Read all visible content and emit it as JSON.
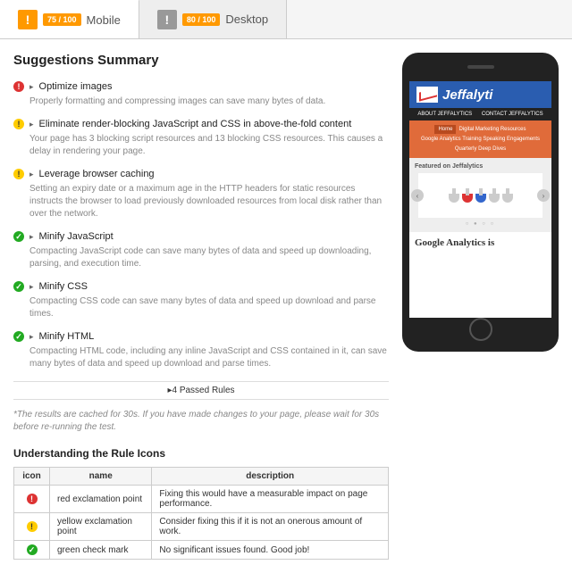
{
  "tabs": {
    "mobile": {
      "score": "75 / 100",
      "label": "Mobile"
    },
    "desktop": {
      "score": "80 / 100",
      "label": "Desktop"
    }
  },
  "summary_title": "Suggestions Summary",
  "suggestions": [
    {
      "severity": "red",
      "title": "Optimize images",
      "desc": "Properly formatting and compressing images can save many bytes of data."
    },
    {
      "severity": "yellow",
      "title": "Eliminate render-blocking JavaScript and CSS in above-the-fold content",
      "desc": "Your page has 3 blocking script resources and 13 blocking CSS resources. This causes a delay in rendering your page."
    },
    {
      "severity": "yellow",
      "title": "Leverage browser caching",
      "desc": "Setting an expiry date or a maximum age in the HTTP headers for static resources instructs the browser to load previously downloaded resources from local disk rather than over the network."
    },
    {
      "severity": "green",
      "title": "Minify JavaScript",
      "desc": "Compacting JavaScript code can save many bytes of data and speed up downloading, parsing, and execution time."
    },
    {
      "severity": "green",
      "title": "Minify CSS",
      "desc": "Compacting CSS code can save many bytes of data and speed up download and parse times."
    },
    {
      "severity": "green",
      "title": "Minify HTML",
      "desc": "Compacting HTML code, including any inline JavaScript and CSS contained in it, can save many bytes of data and speed up download and parse times."
    }
  ],
  "passed_rules": "▸4 Passed Rules",
  "cache_note": "*The results are cached for 30s. If you have made changes to your page, please wait for 30s before re-running the test.",
  "icons_heading": "Understanding the Rule Icons",
  "icons_table": {
    "headers": [
      "icon",
      "name",
      "description"
    ],
    "rows": [
      {
        "severity": "red",
        "name": "red exclamation point",
        "desc": "Fixing this would have a measurable impact on page performance."
      },
      {
        "severity": "yellow",
        "name": "yellow exclamation point",
        "desc": "Consider fixing this if it is not an onerous amount of work."
      },
      {
        "severity": "green",
        "name": "green check mark",
        "desc": "No significant issues found. Good job!"
      }
    ]
  },
  "preview": {
    "brand": "Jeffalyti",
    "menu": [
      "ABOUT JEFFALYTICS",
      "CONTACT JEFFALYTICS"
    ],
    "nav_home": "Home",
    "nav_items": "Digital Marketing Resources",
    "nav_line2": "Google Analytics Training    Speaking Engagements",
    "nav_line3": "Quarterly Deep Dives",
    "featured_label": "Featured on Jeffalytics",
    "headline": "Google Analytics is"
  }
}
